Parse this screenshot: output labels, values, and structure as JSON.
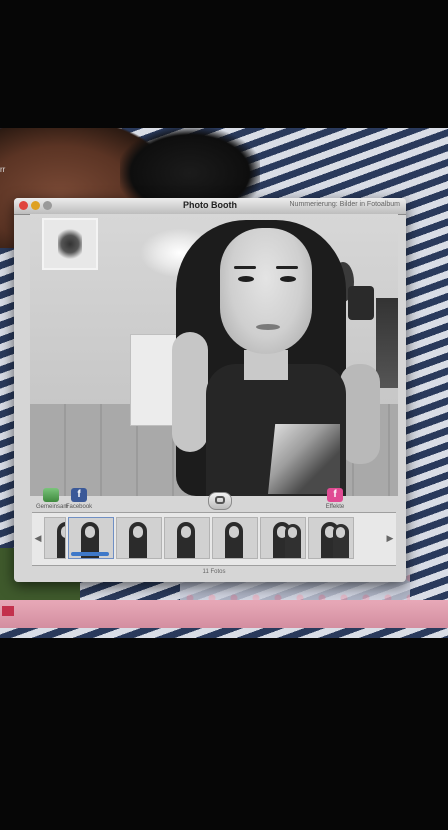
{
  "window": {
    "title": "Photo Booth",
    "subtitle": "Nummerierung: Bilder in Fotoalbum"
  },
  "desktop": {
    "edge_label": "rr"
  },
  "toolbar": {
    "share_label": "Gemeinsam",
    "facebook_label": "Facebook",
    "effects_label": "Effekte"
  },
  "filmstrip": {
    "thumbnail_count": 7,
    "selected_index": 1,
    "footer_label": "11 Fotos"
  }
}
